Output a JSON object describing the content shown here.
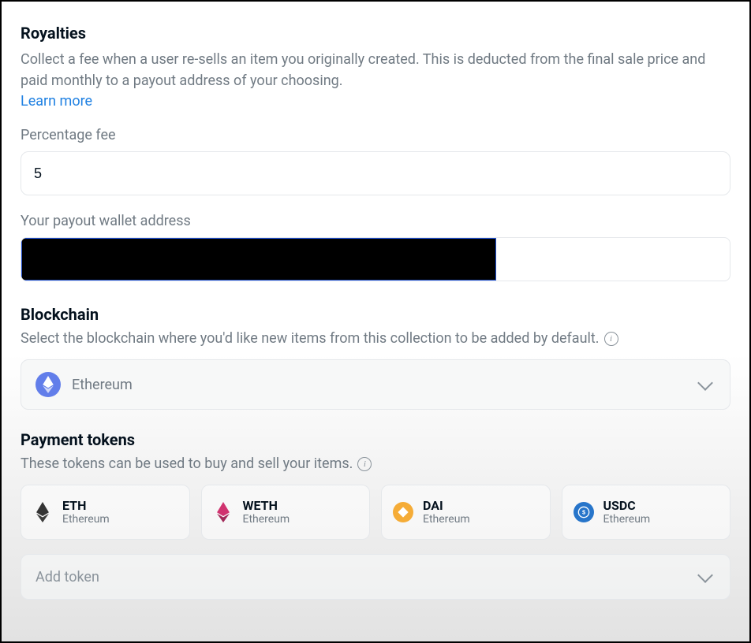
{
  "royalties": {
    "title": "Royalties",
    "description": "Collect a fee when a user re-sells an item you originally created. This is deducted from the final sale price and paid monthly to a payout address of your choosing.",
    "learn_more": "Learn more",
    "percentage_label": "Percentage fee",
    "percentage_value": "5",
    "payout_label": "Your payout wallet address"
  },
  "blockchain": {
    "title": "Blockchain",
    "description": "Select the blockchain where you'd like new items from this collection to be added by default.",
    "selected": "Ethereum"
  },
  "payment_tokens": {
    "title": "Payment tokens",
    "description": "These tokens can be used to buy and sell your items.",
    "tokens": [
      {
        "symbol": "ETH",
        "chain": "Ethereum",
        "icon": "eth-black"
      },
      {
        "symbol": "WETH",
        "chain": "Ethereum",
        "icon": "eth-pink"
      },
      {
        "symbol": "DAI",
        "chain": "Ethereum",
        "icon": "dai"
      },
      {
        "symbol": "USDC",
        "chain": "Ethereum",
        "icon": "usdc"
      }
    ],
    "add_token_label": "Add token"
  }
}
